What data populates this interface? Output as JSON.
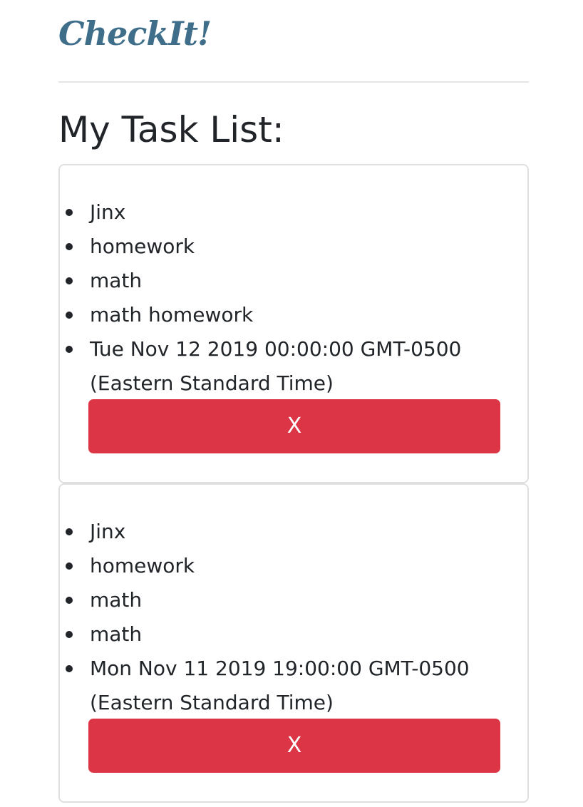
{
  "header": {
    "brand": "CheckIt!"
  },
  "main": {
    "title": "My Task List:",
    "tasks": [
      {
        "items": [
          "Jinx",
          "homework",
          "math",
          "math homework"
        ],
        "date": "Tue Nov 12 2019 00:00:00 GMT-0500 (Eastern Standard Time)",
        "delete_label": "X"
      },
      {
        "items": [
          "Jinx",
          "homework",
          "math",
          "math"
        ],
        "date": "Mon Nov 11 2019 19:00:00 GMT-0500 (Eastern Standard Time)",
        "delete_label": "X"
      }
    ]
  },
  "colors": {
    "brand": "#3f6e8a",
    "delete_button": "#dc3545",
    "text": "#212529",
    "card_border": "#dfdfdf"
  }
}
